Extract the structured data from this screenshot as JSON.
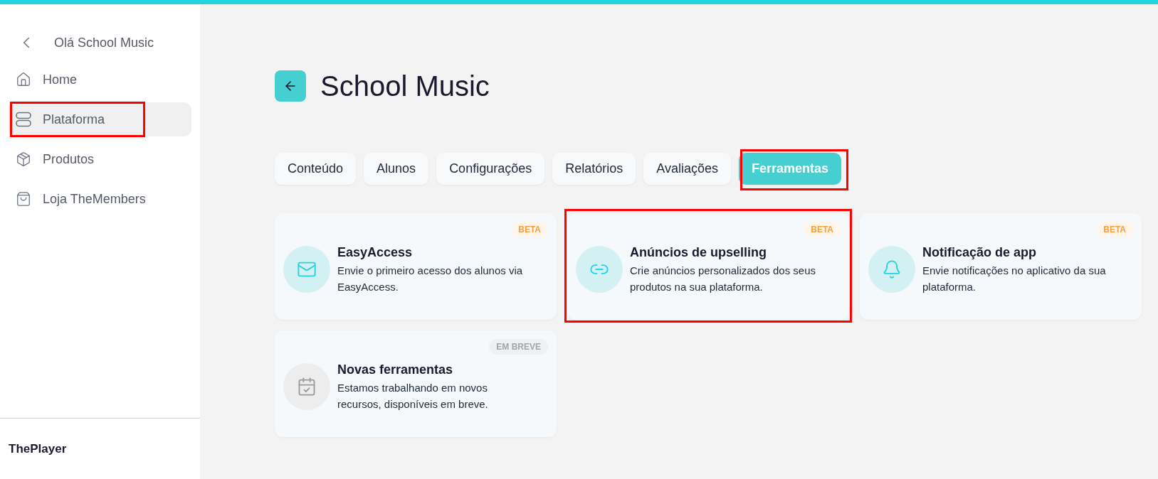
{
  "sidebar": {
    "back_label": "Olá School Music",
    "items": [
      {
        "label": "Home",
        "selected": false,
        "highlighted": false
      },
      {
        "label": "Plataforma",
        "selected": true,
        "highlighted": true
      },
      {
        "label": "Produtos",
        "selected": false,
        "highlighted": false
      },
      {
        "label": "Loja TheMembers",
        "selected": false,
        "highlighted": false
      }
    ],
    "footer": "ThePlayer"
  },
  "page": {
    "title": "School Music"
  },
  "tabs": [
    {
      "label": "Conteúdo",
      "selected": false,
      "highlighted": false
    },
    {
      "label": "Alunos",
      "selected": false,
      "highlighted": false
    },
    {
      "label": "Configurações",
      "selected": false,
      "highlighted": false
    },
    {
      "label": "Relatórios",
      "selected": false,
      "highlighted": false
    },
    {
      "label": "Avaliações",
      "selected": false,
      "highlighted": false
    },
    {
      "label": "Ferramentas",
      "selected": true,
      "highlighted": true
    }
  ],
  "tools": [
    {
      "kind": "beta",
      "badge": "BETA",
      "title": "EasyAccess",
      "description": "Envie o primeiro acesso dos alunos via EasyAccess.",
      "highlighted": false
    },
    {
      "kind": "beta",
      "badge": "BETA",
      "title": "Anúncios de upselling",
      "description": "Crie anúncios personalizados dos seus produtos na sua plataforma.",
      "highlighted": true
    },
    {
      "kind": "beta",
      "badge": "BETA",
      "title": "Notificação de app",
      "description": "Envie notificações no aplicativo da sua plataforma.",
      "highlighted": false
    },
    {
      "kind": "soon",
      "badge": "EM BREVE",
      "title": "Novas ferramentas",
      "description": "Estamos trabalhando em novos recursos, disponíveis em breve.",
      "highlighted": false
    }
  ]
}
